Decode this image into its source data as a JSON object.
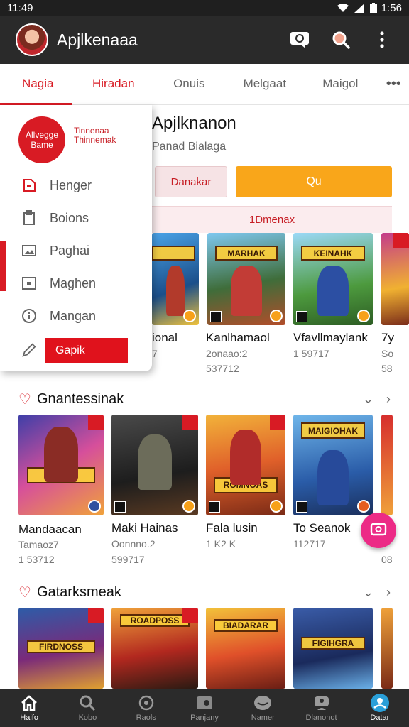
{
  "status": {
    "time_left": "11:49",
    "time_right": "1:56"
  },
  "appbar": {
    "title": "Apjlkenaaa",
    "actions": [
      "chat-icon",
      "search-icon",
      "more-vert-icon"
    ]
  },
  "tabs": [
    {
      "label": "Nagia",
      "color": "#d81b24"
    },
    {
      "label": "Hiradan",
      "color": "#d81b24"
    },
    {
      "label": "Onuis"
    },
    {
      "label": "Melgaat"
    },
    {
      "label": "Maigol"
    },
    {
      "label": "•••"
    }
  ],
  "detail": {
    "title": "Apjlknanon",
    "subtitle": "Panad Bialaga",
    "btn_secondary": "Danakar",
    "btn_primary": "Qu",
    "pink_bar": "1Dmenax"
  },
  "drawer": {
    "logo_line1": "Allvegge",
    "logo_line2": "Bame",
    "brand_line1": "Tinnenaa",
    "brand_line2": "Thinnemak",
    "items": [
      {
        "label": "Henger",
        "icon": "tag-icon"
      },
      {
        "label": "Boions",
        "icon": "clipboard-icon"
      },
      {
        "label": "Paghai",
        "icon": "image-icon"
      },
      {
        "label": "Maghen",
        "icon": "window-icon"
      },
      {
        "label": "Mangan",
        "icon": "info-icon"
      }
    ],
    "button_label": "Gapik"
  },
  "row1": [
    {
      "title": "ional",
      "meta1": "7",
      "meta2": ""
    },
    {
      "title": "Kanlhamaol",
      "meta1": "2onaao:2",
      "meta2": "537712"
    },
    {
      "title": "Vfavllmaylank",
      "meta1": "1 59717",
      "meta2": ""
    },
    {
      "title": "7y",
      "meta1": "So",
      "meta2": "58"
    }
  ],
  "section1": {
    "title": "Gnantessinak"
  },
  "row2": [
    {
      "title": "Mandaacan",
      "meta1": "Tamaoz7",
      "meta2": "1 53712"
    },
    {
      "title": "Maki Hainas",
      "meta1": "Oonnno.2",
      "meta2": "599717"
    },
    {
      "title": "Fala lusin",
      "meta1": "1 K2 K",
      "meta2": ""
    },
    {
      "title": "To Seanok",
      "meta1": "112717",
      "meta2": ""
    },
    {
      "title": "",
      "meta1": "",
      "meta2": "08"
    }
  ],
  "section2": {
    "title": "Gatarksmeak"
  },
  "nav": [
    {
      "label": "Haifo",
      "icon": "home-icon"
    },
    {
      "label": "Kobo",
      "icon": "search-icon"
    },
    {
      "label": "Raols",
      "icon": "compass-icon"
    },
    {
      "label": "Panjany",
      "icon": "gamepad-icon"
    },
    {
      "label": "Namer",
      "icon": "chat-icon"
    },
    {
      "label": "Dlanonot",
      "icon": "person-icon"
    },
    {
      "label": "Datar",
      "icon": "account-icon"
    }
  ],
  "colors": {
    "accent": "#d81b24",
    "orange": "#f9a61a",
    "fab": "#ec2a86",
    "bar": "#2a2a2a"
  }
}
